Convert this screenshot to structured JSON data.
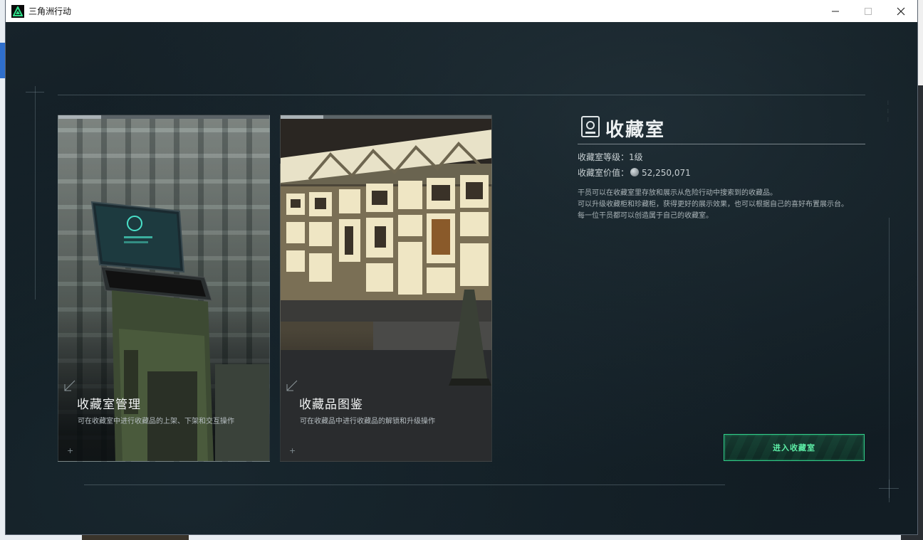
{
  "window": {
    "title": "三角洲行动"
  },
  "cards": [
    {
      "title": "收藏室管理",
      "description": "可在收藏室中进行收藏品的上架、下架和交互操作"
    },
    {
      "title": "收藏品图鉴",
      "description": "可在收藏品中进行收藏品的解锁和升级操作"
    }
  ],
  "info": {
    "title": "收藏室",
    "level_label": "收藏室等级：",
    "level_value": "1级",
    "worth_label": "收藏室价值：",
    "worth_value": "52,250,071",
    "description": [
      "干员可以在收藏室里存放和展示从危险行动中搜索到的收藏品。",
      "可以升级收藏柜和珍藏柜，获得更好的展示效果，也可以根据自己的喜好布置展示台。",
      "每一位干员都可以创造属于自己的收藏室。"
    ]
  },
  "enter_button": {
    "label": "进入收藏室"
  },
  "colors": {
    "accent": "#31d08a",
    "accent_text": "#5ef0a8",
    "background": "#0f1a20"
  }
}
